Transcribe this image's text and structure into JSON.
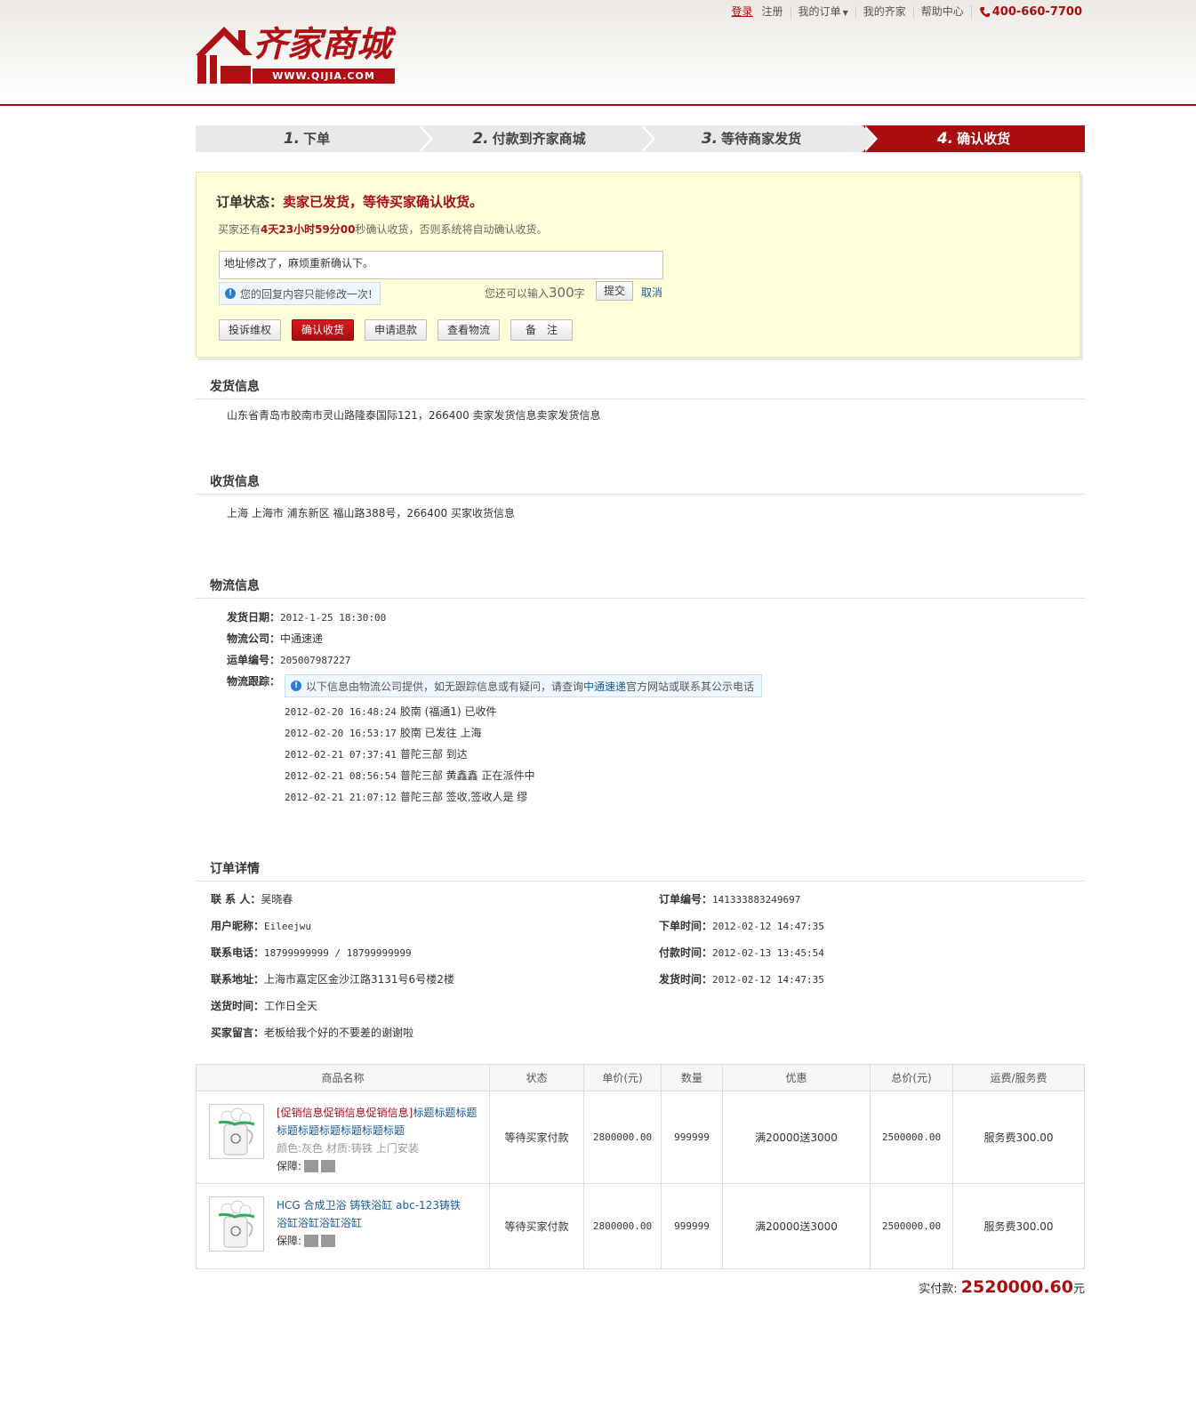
{
  "topnav": {
    "login": "登录",
    "register": "注册",
    "my_orders": "我的订单",
    "my_qijia": "我的齐家",
    "help": "帮助中心",
    "phone": "400-660-7700"
  },
  "logo": {
    "name": "齐家商城",
    "url": "WWW.QIJIA.COM"
  },
  "steps": [
    {
      "num": "1.",
      "label": "下单"
    },
    {
      "num": "2.",
      "label": "付款到齐家商城"
    },
    {
      "num": "3.",
      "label": "等待商家发货"
    },
    {
      "num": "4.",
      "label": "确认收货"
    }
  ],
  "status": {
    "label": "订单状态：",
    "text": "卖家已发货，等待买家确认收货。",
    "countdown_pre": "买家还有",
    "countdown": "4天23小时59分00",
    "countdown_post": "秒确认收货，否则系统将自动确认收货。",
    "reply_value": "地址修改了，麻烦重新确认下。",
    "notice": "您的回复内容只能修改一次!",
    "remaining_pre": "您还可以输入",
    "remaining_num": "300",
    "remaining_post": "字",
    "submit": "提交",
    "cancel": "取消",
    "actions": [
      "投诉维权",
      "确认收货",
      "申请退款",
      "查看物流",
      "备　注"
    ]
  },
  "shipping": {
    "title": "发货信息",
    "text": "山东省青岛市胶南市灵山路隆泰国际121，266400 卖家发货信息卖家发货信息"
  },
  "receiving": {
    "title": "收货信息",
    "text": "上海 上海市 浦东新区 福山路388号，266400 买家收货信息"
  },
  "logistics": {
    "title": "物流信息",
    "ship_date_label": "发货日期：",
    "ship_date": "2012-1-25 18:30:00",
    "company_label": "物流公司：",
    "company": "中通速递",
    "waybill_label": "运单编号：",
    "waybill": "205007987227",
    "tracking_label": "物流跟踪：",
    "notice_pre": "以下信息由物流公司提供，如无跟踪信息或有疑问，请查询",
    "notice_link": "中通速递",
    "notice_post": "官方网站或联系其公示电话",
    "tracks": [
      {
        "time": "2012-02-20 16:48:24",
        "text": "胶南 (福通1) 已收件"
      },
      {
        "time": "2012-02-20 16:53:17",
        "text": "胶南 已发往 上海"
      },
      {
        "time": "2012-02-21 07:37:41",
        "text": "普陀三部 到达"
      },
      {
        "time": "2012-02-21 08:56:54",
        "text": "普陀三部 黄鑫鑫 正在派件中"
      },
      {
        "time": "2012-02-21 21:07:12",
        "text": "普陀三部 签收,签收人是 缪"
      }
    ]
  },
  "order": {
    "title": "订单详情",
    "contact_label": "联 系 人：",
    "contact": "吴晓春",
    "nickname_label": "用户昵称：",
    "nickname": "Eileejwu",
    "phone_label": "联系电话：",
    "phone": "18799999999 / 18799999999",
    "address_label": "联系地址：",
    "address": "上海市嘉定区金沙江路3131号6号楼2楼",
    "delivery_label": "送货时间：",
    "delivery": "工作日全天",
    "message_label": "买家留言：",
    "message": "老板给我个好的不要差的谢谢啦",
    "order_no_label": "订单编号：",
    "order_no": "141333883249697",
    "order_time_label": "下单时间：",
    "order_time": "2012-02-12 14:47:35",
    "pay_time_label": "付款时间：",
    "pay_time": "2012-02-13 13:45:54",
    "ship_time_label": "发货时间：",
    "ship_time": "2012-02-12 14:47:35"
  },
  "goods_table": {
    "headers": [
      "商品名称",
      "状态",
      "单价(元)",
      "数量",
      "优惠",
      "总价(元)",
      "运费/服务费"
    ],
    "rows": [
      {
        "promo": "[促销信息促销信息促销信息]",
        "title": "标题标题标题标题标题标题标题标题标题",
        "attr": "颜色:灰色 材质:铸铁 上门安装",
        "guarantee": "保障:",
        "status": "等待买家付款",
        "price": "2800000.00",
        "qty": "999999",
        "discount": "满20000送3000",
        "total": "2500000.00",
        "fee": "服务费300.00"
      },
      {
        "promo": "",
        "title": "HCG 合成卫浴 铸铁浴缸 abc-123铸铁浴缸浴缸浴缸浴缸",
        "attr": "",
        "guarantee": "保障:",
        "status": "等待买家付款",
        "price": "2800000.00",
        "qty": "999999",
        "discount": "满20000送3000",
        "total": "2500000.00",
        "fee": "服务费300.00"
      }
    ]
  },
  "payment": {
    "label": "实付款:",
    "amount": "2520000.60",
    "unit": "元"
  },
  "colors": {
    "brand": "#a80d10",
    "link": "#1a5a9c",
    "status_bg": "#ffffd9"
  }
}
